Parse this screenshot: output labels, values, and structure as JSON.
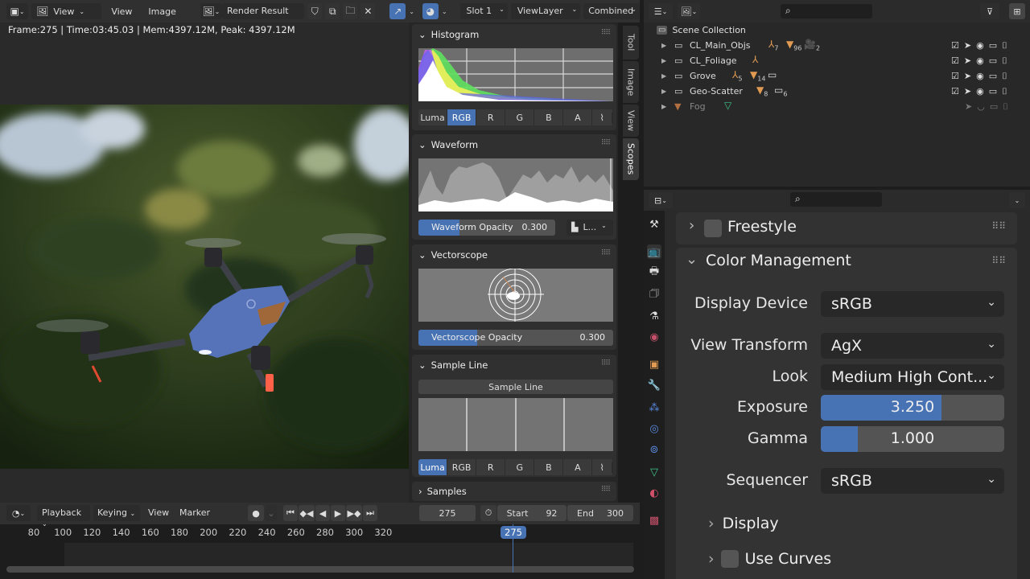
{
  "image_editor": {
    "header": {
      "view_menu_dropdown": "View",
      "menus": [
        "View",
        "Image"
      ],
      "image_name": "Render Result",
      "slot": "Slot 1",
      "view_layer": "ViewLayer",
      "pass": "Combined"
    },
    "info_line": "Frame:275 | Time:03:45.03 | Mem:4397.12M, Peak: 4397.12M",
    "sidebar_tabs": [
      "Tool",
      "Image",
      "View",
      "Scopes"
    ],
    "active_sidebar_tab": "Scopes"
  },
  "scopes": {
    "histogram": {
      "title": "Histogram",
      "modes": [
        "Luma",
        "RGB",
        "R",
        "G",
        "B",
        "A"
      ],
      "active_mode": "RGB"
    },
    "waveform": {
      "title": "Waveform",
      "opacity_label": "Waveform Opacity",
      "opacity_value": "0.300",
      "opacity_fraction": 0.3,
      "mode_dropdown": "L..."
    },
    "vectorscope": {
      "title": "Vectorscope",
      "opacity_label": "Vectorscope Opacity",
      "opacity_value": "0.300",
      "opacity_fraction": 0.3
    },
    "sample_line": {
      "title": "Sample Line",
      "button_label": "Sample Line",
      "modes": [
        "Luma",
        "RGB",
        "R",
        "G",
        "B",
        "A"
      ],
      "active_mode": "Luma"
    },
    "samples": {
      "title": "Samples"
    }
  },
  "outliner": {
    "root": "Scene Collection",
    "rows": [
      {
        "name": "CL_Main_Objs",
        "badges": [
          {
            "icon": "armature",
            "count": "7"
          },
          {
            "icon": "mesh",
            "count": "96"
          },
          {
            "icon": "camera",
            "count": "2"
          }
        ]
      },
      {
        "name": "CL_Foliage",
        "badges": [
          {
            "icon": "armature",
            "count": ""
          }
        ]
      },
      {
        "name": "Grove",
        "badges": [
          {
            "icon": "armature",
            "count": "5"
          },
          {
            "icon": "mesh",
            "count": "14"
          },
          {
            "icon": "collection",
            "count": ""
          }
        ]
      },
      {
        "name": "Geo-Scatter",
        "badges": [
          {
            "icon": "mesh",
            "count": "8"
          },
          {
            "icon": "collection",
            "count": "6"
          }
        ]
      },
      {
        "name": "Fog",
        "badges": [
          {
            "icon": "mesh-data",
            "count": ""
          }
        ]
      }
    ]
  },
  "properties": {
    "panels": {
      "freestyle": "Freestyle",
      "color_management": "Color Management"
    },
    "fields": {
      "display_device_label": "Display Device",
      "display_device_value": "sRGB",
      "view_transform_label": "View Transform",
      "view_transform_value": "AgX",
      "look_label": "Look",
      "look_value": "Medium High Cont...",
      "exposure_label": "Exposure",
      "exposure_value": "3.250",
      "exposure_fraction": 0.66,
      "gamma_label": "Gamma",
      "gamma_value": "1.000",
      "gamma_fraction": 0.2,
      "sequencer_label": "Sequencer",
      "sequencer_value": "sRGB"
    },
    "subpanels": {
      "display": "Display",
      "use_curves": "Use Curves"
    }
  },
  "timeline": {
    "menus": [
      "Playback",
      "Keying",
      "View",
      "Marker"
    ],
    "current_frame": "275",
    "start_label": "Start",
    "start_value": "92",
    "end_label": "End",
    "end_value": "300",
    "ticks": [
      "80",
      "100",
      "120",
      "140",
      "160",
      "180",
      "200",
      "220",
      "240",
      "260",
      "280",
      "300",
      "320"
    ],
    "playhead": "275"
  },
  "colors": {
    "accent": "#4772b3",
    "object_orange": "#e09a52"
  }
}
